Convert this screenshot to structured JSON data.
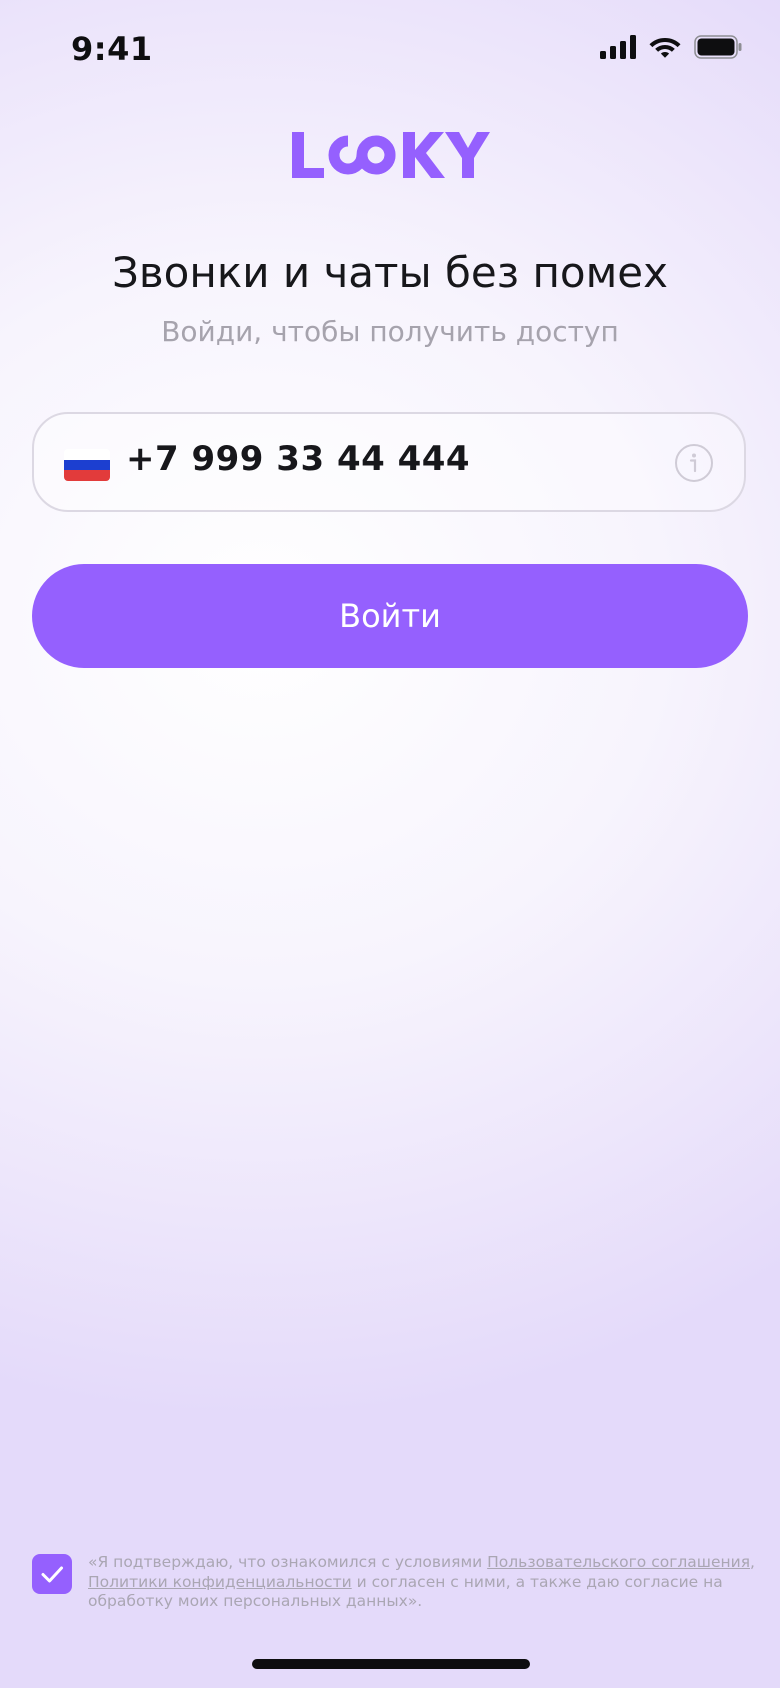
{
  "status_bar": {
    "time": "9:41",
    "icons": [
      "cellular-signal-icon",
      "wifi-icon",
      "battery-icon"
    ]
  },
  "brand": {
    "logo_text": "LOOKY",
    "accent_color": "#9560FE"
  },
  "header": {
    "title": "Звонки и чаты без помех",
    "subtitle": "Войди, чтобы получить доступ"
  },
  "phone_input": {
    "country_flag": "russia-flag-icon",
    "value": "+7 999 33 44 444",
    "info_icon": "info-icon"
  },
  "login_button": {
    "label": "Войти"
  },
  "consent": {
    "checked": true,
    "text_start": "«Я подтверждаю, что ознакомился с условиями ",
    "link_terms": "Пользовательского соглашения",
    "text_comma": ", ",
    "link_privacy": "Политики конфиденциальности",
    "text_end": " и согласен с ними, а также даю согласие на обработку моих персональных данных»."
  }
}
